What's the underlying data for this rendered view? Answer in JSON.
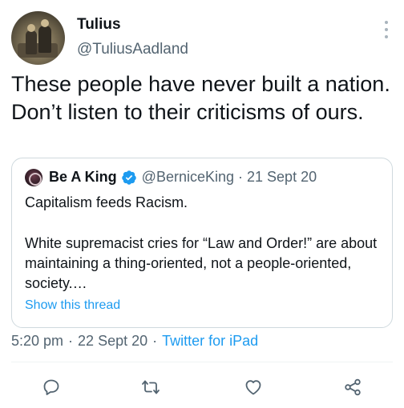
{
  "tweet": {
    "author_name": "Tulius",
    "author_handle": "@TuliusAadland",
    "text": "These people have never built a nation. Don’t listen to their criticisms of ours.",
    "time": "5:20 pm",
    "date": "22 Sept 20",
    "source": "Twitter for iPad",
    "separator": "·"
  },
  "quoted": {
    "author_name": "Be A King",
    "author_handle": "@BerniceKing",
    "separator": "·",
    "date": "21 Sept 20",
    "line1": "Capitalism feeds Racism.",
    "body": "White supremacist cries for “Law and Order!” are about maintaining a thing-oriented, not a people-oriented, society.…",
    "show_thread": "Show this thread",
    "verified": true
  },
  "icons": {
    "reply": "reply-icon",
    "retweet": "retweet-icon",
    "like": "like-icon",
    "share": "share-icon",
    "more": "more-icon",
    "verified": "verified-badge-icon"
  },
  "colors": {
    "accent": "#1d9bf0",
    "muted": "#536471",
    "text": "#0f1419",
    "border": "#cfd9de"
  }
}
